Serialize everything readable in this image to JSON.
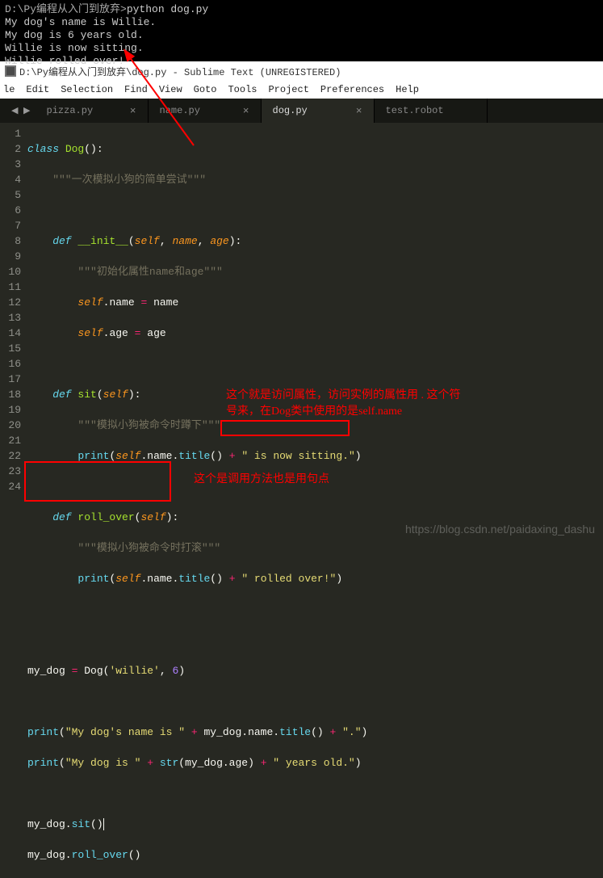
{
  "terminal": {
    "line1_prompt": "D:\\Py编程从入门到放弃>",
    "line1_cmd": "python dog.py",
    "line2": "My dog's name is Willie.",
    "line3": "My dog is 6 years old.",
    "line4": "Willie is now sitting.",
    "line5": "Willie rolled over!"
  },
  "titlebar": {
    "text": "D:\\Py编程从入门到放弃\\dog.py - Sublime Text (UNREGISTERED)"
  },
  "menu": {
    "file": "le",
    "edit": "Edit",
    "selection": "Selection",
    "find": "Find",
    "view": "View",
    "goto": "Goto",
    "tools": "Tools",
    "project": "Project",
    "preferences": "Preferences",
    "help": "Help"
  },
  "tabs": {
    "t1": "pizza.py",
    "t2": "name.py",
    "t3": "dog.py",
    "t4": "test.robot"
  },
  "gutter": [
    "1",
    "2",
    "3",
    "4",
    "5",
    "6",
    "7",
    "8",
    "9",
    "10",
    "11",
    "12",
    "13",
    "14",
    "15",
    "16",
    "17",
    "18",
    "19",
    "20",
    "21",
    "22",
    "23",
    "24"
  ],
  "code": {
    "l1a": "class ",
    "l1b": "Dog",
    "l1c": "():",
    "l2": "    \"\"\"一次模拟小狗的简单尝试\"\"\"",
    "l4a": "    def ",
    "l4b": "__init__",
    "l4c": "(",
    "l4d": "self",
    "l4e": ", ",
    "l4f": "name",
    "l4g": ", ",
    "l4h": "age",
    "l4i": "):",
    "l5": "        \"\"\"初始化属性name和age\"\"\"",
    "l6a": "        ",
    "l6b": "self",
    "l6c": ".name ",
    "l6d": "=",
    "l6e": " name",
    "l7a": "        ",
    "l7b": "self",
    "l7c": ".age ",
    "l7d": "=",
    "l7e": " age",
    "l9a": "    def ",
    "l9b": "sit",
    "l9c": "(",
    "l9d": "self",
    "l9e": "):",
    "l10": "        \"\"\"模拟小狗被命令时蹲下\"\"\"",
    "l11a": "        ",
    "l11b": "print",
    "l11c": "(",
    "l11d": "self",
    "l11e": ".name.",
    "l11f": "title",
    "l11g": "() ",
    "l11h": "+",
    "l11i": " \" is now sitting.\"",
    "l11j": ")",
    "l13a": "    def ",
    "l13b": "roll_over",
    "l13c": "(",
    "l13d": "self",
    "l13e": "):",
    "l14": "        \"\"\"模拟小狗被命令时打滚\"\"\"",
    "l15a": "        ",
    "l15b": "print",
    "l15c": "(",
    "l15d": "self",
    "l15e": ".name.",
    "l15f": "title",
    "l15g": "() ",
    "l15h": "+",
    "l15i": " \" rolled over!\"",
    "l15j": ")",
    "l18a": "my_dog ",
    "l18b": "=",
    "l18c": " Dog(",
    "l18d": "'willie'",
    "l18e": ", ",
    "l18f": "6",
    "l18g": ")",
    "l20a": "print",
    "l20b": "(",
    "l20c": "\"My dog's name is \"",
    "l20d": " + ",
    "l20e": "my_dog.name.",
    "l20f": "title",
    "l20g": "()",
    "l20h": " + ",
    "l20i": "\".\"",
    "l20j": ")",
    "l21a": "print",
    "l21b": "(",
    "l21c": "\"My dog is \"",
    "l21d": " + ",
    "l21e": "str",
    "l21f": "(my_dog.age) ",
    "l21g": "+",
    "l21h": " \" years old.\"",
    "l21i": ")",
    "l23a": "my_dog.",
    "l23b": "sit",
    "l23c": "()",
    "l24a": "my_dog.",
    "l24b": "roll_over",
    "l24c": "()"
  },
  "anno": {
    "a1": "这个就是访问属性，访问实例的属性用  . 这个符",
    "a2": "号来，在Dog类中使用的是self.name",
    "a3": "这个是调用方法也是用句点"
  },
  "watermark": "https://blog.csdn.net/paidaxing_dashu"
}
